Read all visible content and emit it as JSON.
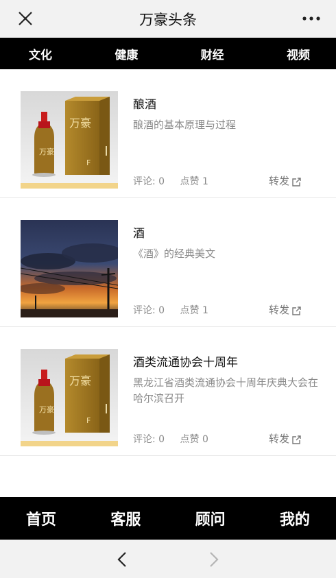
{
  "header": {
    "title": "万豪头条",
    "close_icon": "close-icon",
    "more_icon": "more-icon"
  },
  "top_nav": [
    {
      "label": "文化"
    },
    {
      "label": "健康"
    },
    {
      "label": "财经"
    },
    {
      "label": "视频"
    }
  ],
  "articles": [
    {
      "title": "酿酒",
      "desc": "酿酒的基本原理与过程",
      "comments": "评论: 0",
      "likes": "点赞 1",
      "share": "转发",
      "image": "baijiu-bottle-box",
      "brand_text": "万豪",
      "brand_mark": "F"
    },
    {
      "title": "酒",
      "desc": "《酒》的经典美文",
      "comments": "评论: 0",
      "likes": "点赞 1",
      "share": "转发",
      "image": "sunset-sky-painting"
    },
    {
      "title": "酒类流通协会十周年",
      "desc": "黑龙江省酒类流通协会十周年庆典大会在哈尔滨召开",
      "comments": "评论: 0",
      "likes": "点赞 0",
      "share": "转发",
      "image": "baijiu-bottle-box",
      "brand_text": "万豪",
      "brand_mark": "F"
    }
  ],
  "bottom_nav": [
    {
      "label": "首页"
    },
    {
      "label": "客服"
    },
    {
      "label": "顾问"
    },
    {
      "label": "我的"
    }
  ],
  "colors": {
    "nav_bg": "#000000",
    "nav_text": "#ffffff",
    "bar_bg": "#f2f2f2",
    "muted": "#8a8a8a",
    "gold": "#a67c1f"
  }
}
